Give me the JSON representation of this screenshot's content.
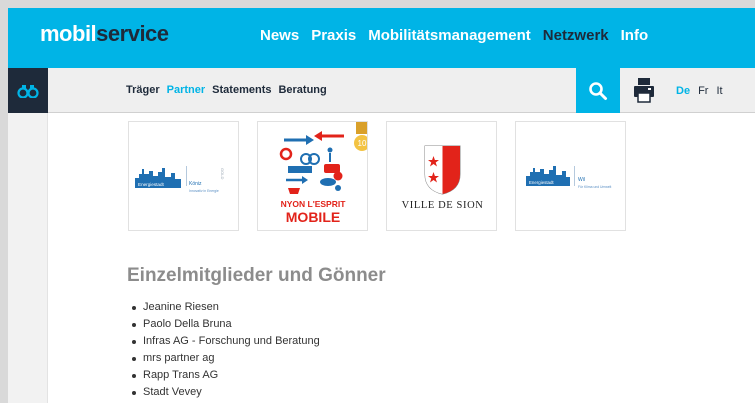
{
  "header": {
    "logo_part1": "mobil",
    "logo_part2": "service",
    "nav": [
      "News",
      "Praxis",
      "Mobilitätsmanagement",
      "Netzwerk",
      "Info"
    ],
    "active_nav": "Netzwerk"
  },
  "subnav": {
    "items": [
      "Träger",
      "Partner",
      "Statements",
      "Beratung"
    ],
    "active": "Partner"
  },
  "languages": [
    "De",
    "Fr",
    "It"
  ],
  "active_language": "De",
  "partners": [
    {
      "name": "Energiestadt Köniz",
      "label": "Energiestadt",
      "city": "Köniz",
      "tagline": "Innovativ in Energie",
      "badge": "GOLD"
    },
    {
      "name": "Nyon l'esprit mobile",
      "line1": "NYON L'ESPRIT",
      "line2": "MOBILE",
      "badge": "10"
    },
    {
      "name": "Ville de Sion",
      "label": "VILLE DE SION"
    },
    {
      "name": "Energiestadt Wil",
      "label": "Energiestadt",
      "city": "Wil",
      "tagline": "Für Klima und Umwelt"
    }
  ],
  "members_section": {
    "title": "Einzelmitglieder und Gönner",
    "items": [
      "Jeanine Riesen",
      "Paolo Della Bruna",
      "Infras AG - Forschung und Beratung",
      "mrs partner ag",
      "Rapp Trans AG",
      "Stadt Vevey"
    ]
  },
  "colors": {
    "brand": "#00b4e6",
    "dark": "#1e2a3a",
    "sion_red": "#e2231a",
    "energie_blue": "#1f6fb2"
  }
}
